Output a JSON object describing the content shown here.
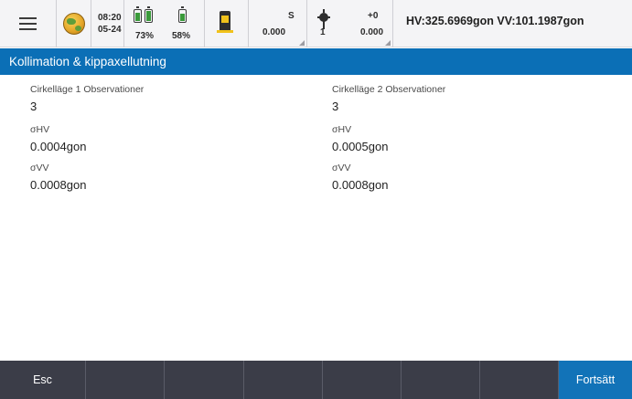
{
  "status": {
    "time": "08:20",
    "date": "05-24",
    "battery1_percent": "73%",
    "battery2_percent": "58%",
    "battery1_level": 0.73,
    "battery2_level": 0.58,
    "target_label": "S",
    "target_value": "0.000",
    "prism_index": "1",
    "prism_offset": "+0",
    "prism_value": "0.000",
    "angles": "HV:325.6969gon  VV:101.1987gon",
    "icons": [
      "menu-icon",
      "globe-icon",
      "battery-icon",
      "battery-icon",
      "total-station-icon",
      "prism-icon"
    ]
  },
  "title": "Kollimation & kippaxellutning",
  "left": {
    "obs_label": "Cirkelläge 1 Observationer",
    "obs_value": "3",
    "shv_label": "σHV",
    "shv_value": "0.0004gon",
    "svv_label": "σVV",
    "svv_value": "0.0008gon"
  },
  "right": {
    "obs_label": "Cirkelläge 2 Observationer",
    "obs_value": "3",
    "shv_label": "σHV",
    "shv_value": "0.0005gon",
    "svv_label": "σVV",
    "svv_value": "0.0008gon"
  },
  "softkeys": {
    "esc": "Esc",
    "continue": "Fortsätt"
  },
  "colors": {
    "title_bar": "#0b6fb6",
    "softkey_bar": "#3b3d48",
    "primary_key": "#1273b8",
    "battery_fill": "#3a9a3a"
  }
}
